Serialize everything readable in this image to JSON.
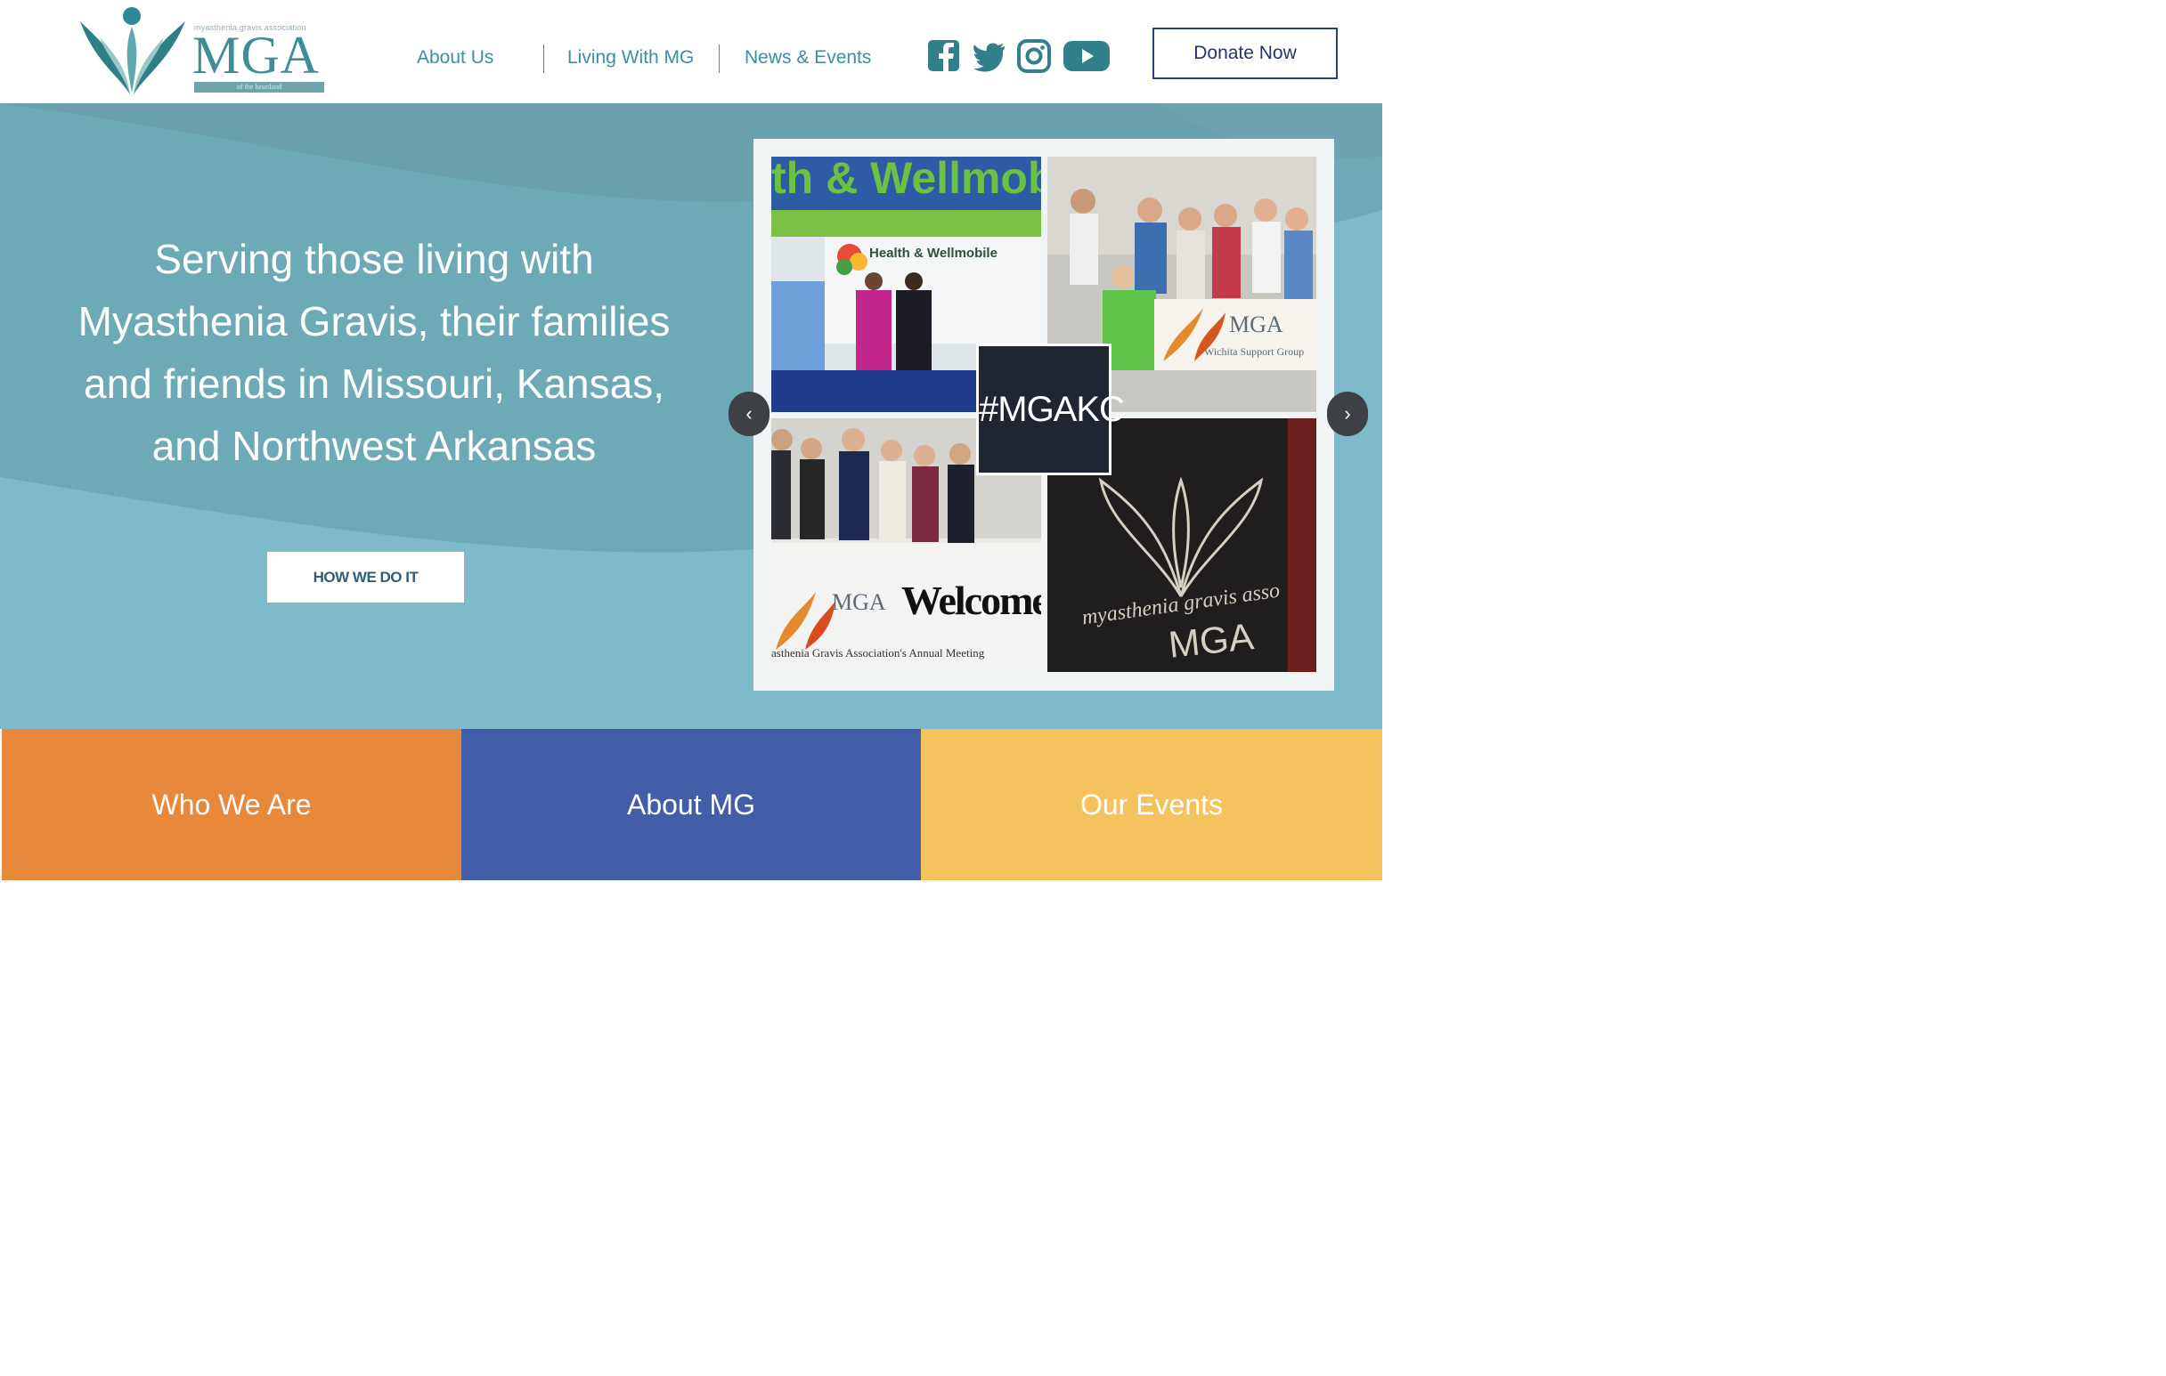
{
  "logo": {
    "small_text": "myasthenia gravis association",
    "big_text": "MGA",
    "ribbon_text": "of the heartland"
  },
  "nav": {
    "about_us": "About Us",
    "living_with_mg": "Living With MG",
    "news_events": "News & Events"
  },
  "social": [
    "facebook-icon",
    "twitter-icon",
    "instagram-icon",
    "youtube-icon"
  ],
  "donate_label": "Donate Now",
  "hero": {
    "headline": "Serving those living with Myasthenia Gravis, their families and friends in Missouri, Kansas, and Northwest Arkansas",
    "cta_label": "HOW WE DO IT",
    "collage": {
      "tile1_banner": "th & Wellmob",
      "tile1_sign": "Health & Wellmobile",
      "tile2_banner_brand": "MGA",
      "tile2_banner_sub": "Wichita Support Group",
      "center_tag": "#MGAKC",
      "tile3_brand": "MGA",
      "tile3_welcome": "Welcome",
      "tile3_caption": "asthenia Gravis Association's Annual Meeting",
      "tile4_script": "myasthenia gravis asso",
      "tile4_brand": "MGA"
    },
    "prev_icon": "‹",
    "next_icon": "›"
  },
  "features": {
    "who_we_are": "Who We Are",
    "about_mg": "About MG",
    "our_events": "Our Events"
  },
  "colors": {
    "teal": "#3e8ea0",
    "hero_bg": "#7fb9cc",
    "orange": "#e8883a",
    "blue": "#435ea9",
    "yellow": "#f5c35d",
    "navy": "#2c3f7c"
  }
}
